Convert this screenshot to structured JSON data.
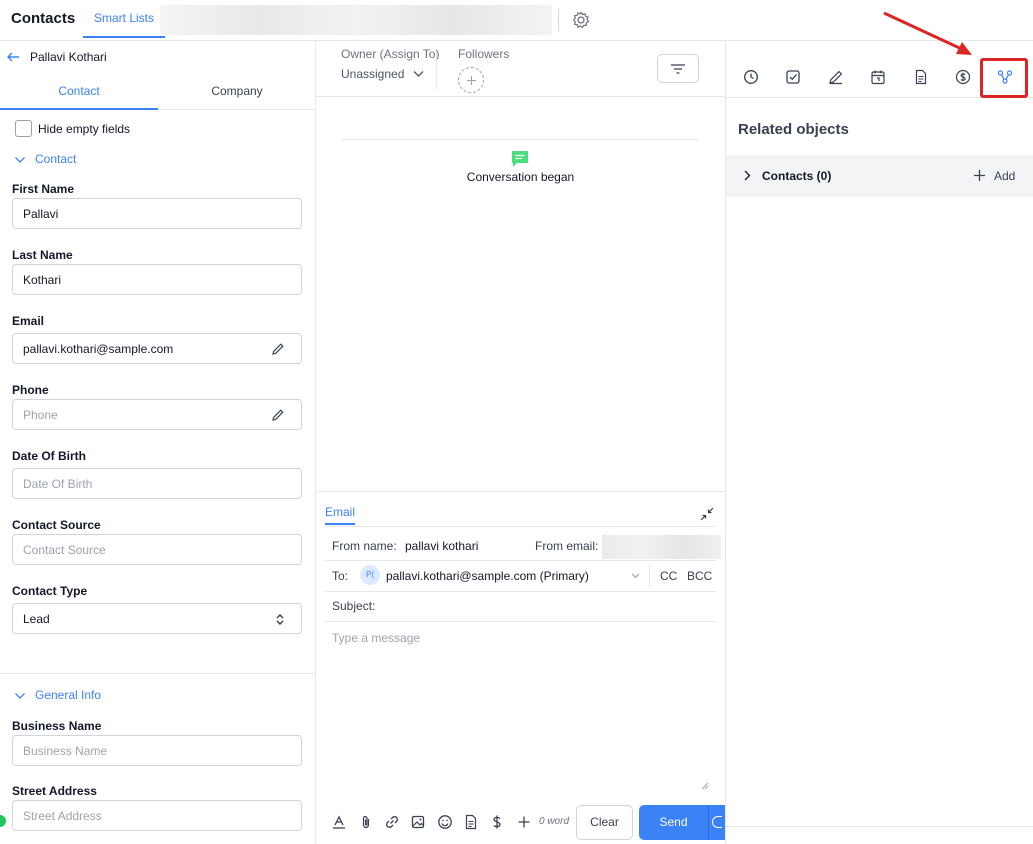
{
  "header": {
    "title": "Contacts",
    "smart_lists": "Smart Lists"
  },
  "left": {
    "back_name": "Pallavi Kothari",
    "tabs": [
      "Contact",
      "Company"
    ],
    "hide_empty": "Hide empty fields",
    "sections": {
      "contact": "Contact",
      "general": "General Info"
    },
    "fields": {
      "first_name": {
        "label": "First Name",
        "value": "Pallavi"
      },
      "last_name": {
        "label": "Last Name",
        "value": "Kothari"
      },
      "email": {
        "label": "Email",
        "value": "pallavi.kothari@sample.com"
      },
      "phone": {
        "label": "Phone",
        "placeholder": "Phone"
      },
      "dob": {
        "label": "Date Of Birth",
        "placeholder": "Date Of Birth"
      },
      "source": {
        "label": "Contact Source",
        "placeholder": "Contact Source"
      },
      "type": {
        "label": "Contact Type",
        "value": "Lead"
      },
      "business": {
        "label": "Business Name",
        "placeholder": "Business Name"
      },
      "street": {
        "label": "Street Address",
        "placeholder": "Street Address"
      }
    }
  },
  "middle": {
    "owner_label": "Owner (Assign To)",
    "owner_value": "Unassigned",
    "followers_label": "Followers",
    "conversation": "Conversation began",
    "composer": {
      "tab": "Email",
      "from_name_label": "From name:",
      "from_name_value": "pallavi kothari",
      "from_email_label": "From email:",
      "to_label": "To:",
      "to_avatar": "P(",
      "to_value": "pallavi.kothari@sample.com (Primary)",
      "cc": "CC",
      "bcc": "BCC",
      "subject_label": "Subject:",
      "message_placeholder": "Type a message",
      "word_count": "0 word",
      "clear": "Clear",
      "send": "Send"
    }
  },
  "right": {
    "title": "Related objects",
    "contacts_label": "Contacts (0)",
    "add_label": "Add",
    "icons": [
      "clock-icon",
      "task-check-icon",
      "pen-icon",
      "calendar-icon",
      "document-icon",
      "dollar-icon",
      "relations-icon"
    ]
  },
  "colors": {
    "accent": "#3b82f6",
    "highlight": "#dc2626",
    "chat": "#4ade80"
  }
}
